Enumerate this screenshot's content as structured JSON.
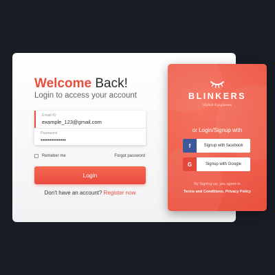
{
  "login": {
    "title_accent": "Welcome",
    "title_rest": " Back!",
    "subtitle": "Login to access your account",
    "email": {
      "label": "Email ID",
      "value": "example_123@gmail.com"
    },
    "password": {
      "label": "Password",
      "value": "••••••••••••••"
    },
    "remember_label": "Remeber me",
    "forgot_label": "Forgot password",
    "login_button": "Login",
    "signup_prompt": "Don't have an account? ",
    "signup_link": "Register now"
  },
  "panel": {
    "brand": "BLINKERS",
    "tagline": "Stylish Eyeglasses",
    "heading": "or Login/Signup with",
    "facebook": {
      "icon": "facebook-icon",
      "glyph": "f",
      "label": "Signup with facebook"
    },
    "google": {
      "icon": "google-icon",
      "glyph": "G",
      "label": "Signup with Google"
    },
    "agree_text": "By Signing up, you agree to",
    "terms_text": "Terms and Conditions, Privacy Policy"
  },
  "colors": {
    "background": "#181c25",
    "accent": "#e84e3c",
    "panel": "#ef5e4c",
    "facebook": "#3b5998",
    "google": "#e2483a"
  }
}
